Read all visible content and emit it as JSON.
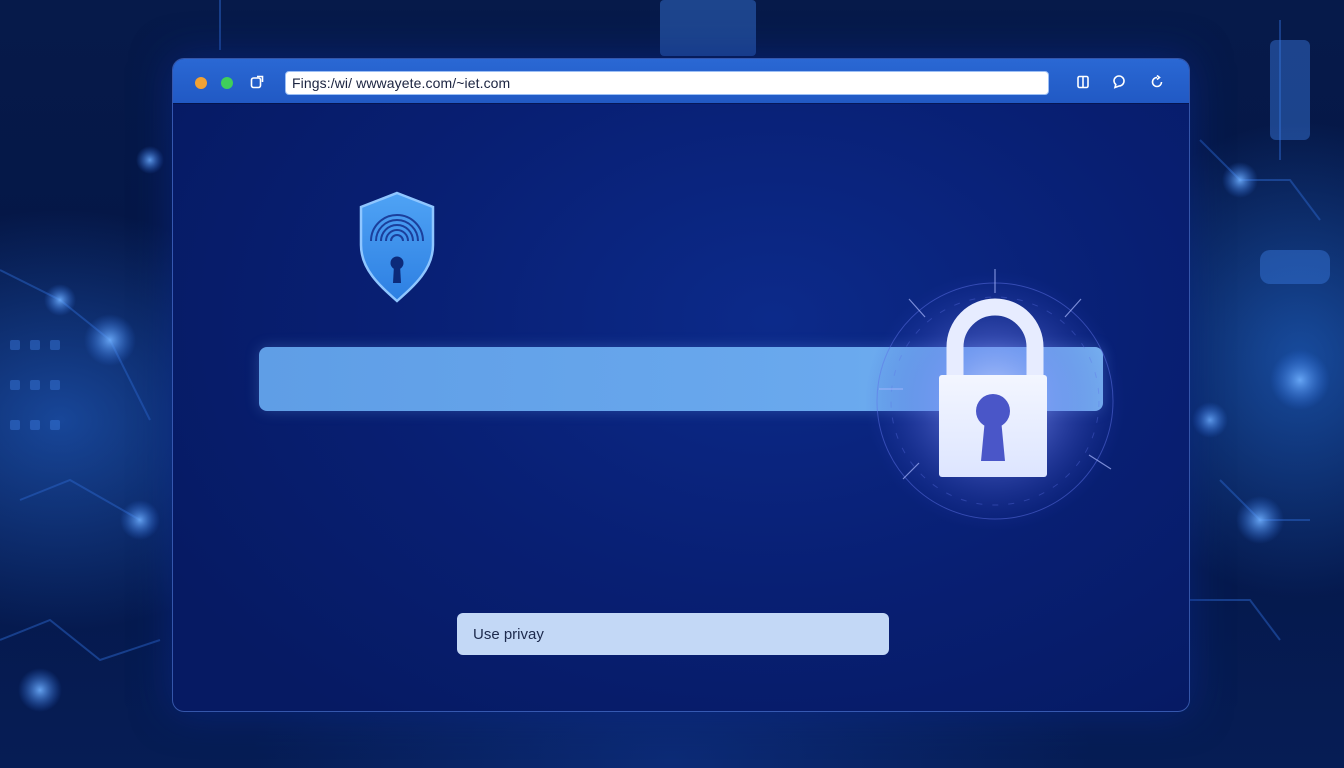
{
  "browser": {
    "url": "Fings:/wi/ wwwayete.com/~iet.com",
    "toolbar_icons": [
      "sidebar-icon",
      "chat-icon",
      "refresh-icon"
    ],
    "nav_icon": "new-tab-icon"
  },
  "content": {
    "shield_icon": "shield-fingerprint-lock-icon",
    "lock_icon": "padlock-icon",
    "privacy_button_label": "Use privay"
  },
  "colors": {
    "titlebar": "#2159c4",
    "window_background": "#081f73",
    "field": "#6aa9ee",
    "button": "#c3d8f6"
  }
}
